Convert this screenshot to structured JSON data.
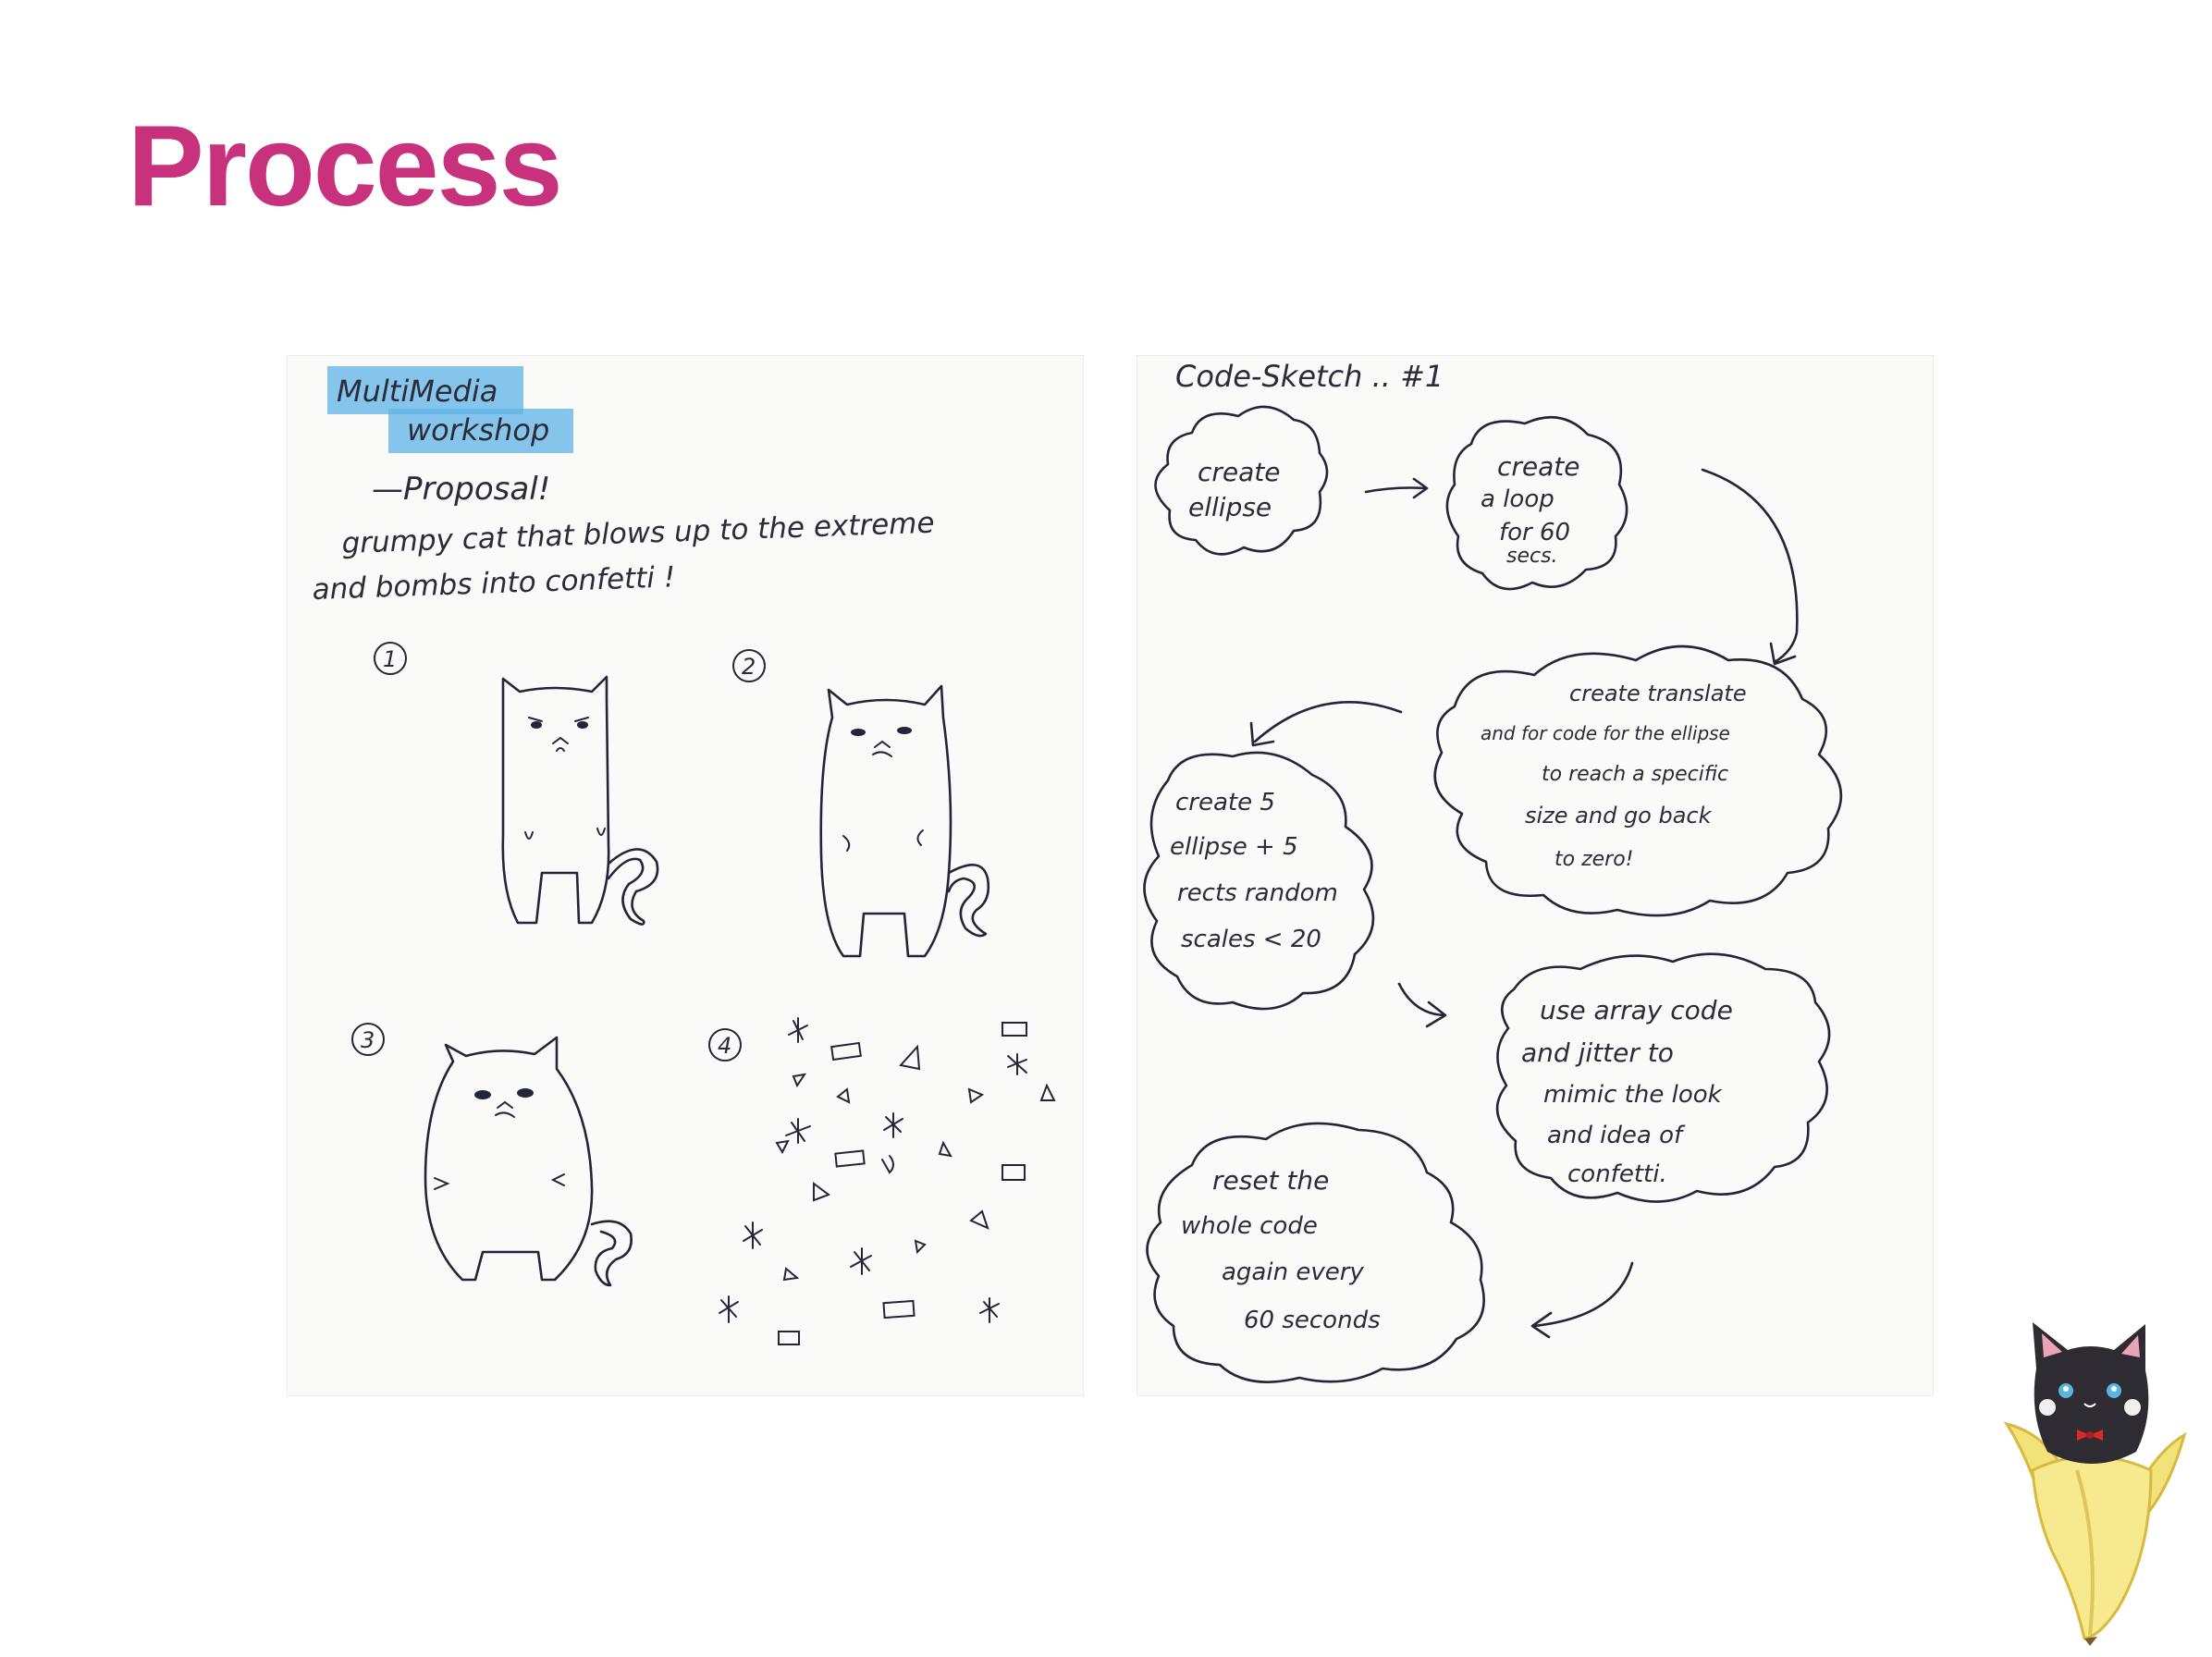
{
  "slide": {
    "title": "Process"
  },
  "left_sketch": {
    "header_line1": "MultiMedia",
    "header_line2": "workshop",
    "proposal_label": "—Proposal!",
    "proposal_line1": "grumpy cat that blows up to the extreme",
    "proposal_line2": "and bombs into confetti !",
    "steps": [
      "1",
      "2",
      "3",
      "4"
    ],
    "highlight_color": "#5fb3e6"
  },
  "right_sketch": {
    "title": "Code-Sketch .. #1",
    "clouds": [
      {
        "lines": [
          "create",
          "ellipse"
        ]
      },
      {
        "lines": [
          "create",
          "a loop",
          "for 60",
          "secs."
        ]
      },
      {
        "lines": [
          "create translate",
          "and for code for the ellipse",
          "to reach a specific",
          "size and go back",
          "to zero!"
        ]
      },
      {
        "lines": [
          "create 5",
          "ellipse + 5",
          "rects random",
          "scales < 20"
        ]
      },
      {
        "lines": [
          "use array code",
          "and jitter to",
          "mimic the look",
          "and idea of",
          "confetti."
        ]
      },
      {
        "lines": [
          "reset the",
          "whole code",
          "again every",
          "60 seconds"
        ]
      }
    ]
  },
  "colors": {
    "accent": "#c8327c",
    "ink": "#25253a",
    "banana": "#f2e27a"
  },
  "icons": {
    "mascot": "cat-in-banana-icon"
  }
}
